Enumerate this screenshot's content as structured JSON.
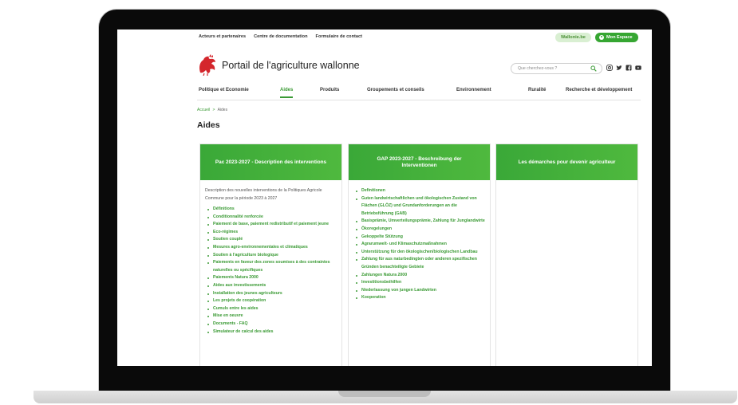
{
  "topbar": {
    "links": [
      "Acteurs et partenaires",
      "Centre de documentation",
      "Formulaire de contact"
    ],
    "wallonie_label": "Wallonie.be",
    "espace_label": "Mon Espace"
  },
  "header": {
    "title": "Portail de l'agriculture wallonne",
    "search_placeholder": "Que cherchez-vous ?"
  },
  "colors": {
    "brand_green": "#36a632",
    "logo_red": "#d4262c"
  },
  "icons": [
    "rooster-logo-icon",
    "search-icon",
    "instagram-icon",
    "twitter-icon",
    "facebook-icon",
    "youtube-icon",
    "user-icon"
  ],
  "nav": {
    "items": [
      "Politique et Economie",
      "Aides",
      "Produits",
      "Groupements et conseils",
      "Environnement",
      "Ruralité",
      "Recherche et développement"
    ],
    "active": "Aides"
  },
  "breadcrumb": {
    "home": "Accueil",
    "separator": ">",
    "current": "Aides"
  },
  "page_title": "Aides",
  "cards": [
    {
      "title": "Pac 2023-2027 - Description des interventions",
      "description": "Description des nouvelles interventions de la Politiques Agricole Commune pour la période 2023 à 2027",
      "links": [
        "Définitions",
        "Conditionnalité renforcée",
        "Paiement de base, paiement redistributif et paiement jeune",
        "Eco-régimes",
        "Soutien couplé",
        "Mesures agro-environnementales et climatiques",
        "Soutien à l'agriculture biologique",
        "Paiements en faveur des zones soumises à des contraintes naturelles ou spécifiques",
        "Paiements Natura 2000",
        "Aides aux investissements",
        "Installation des jeunes agriculteurs",
        "Les projets de coopération",
        "Cumuls entre les aides",
        "Mise en oeuvre",
        "Documents - FAQ",
        "Simulateur de calcul des aides"
      ]
    },
    {
      "title": "GAP 2023-2027 - Beschreibung der Interventionen",
      "description": "",
      "links": [
        "Definitionen",
        "Guten landwirtschaftlichen und ökologischen Zustand von Flächen (GLÖZ) und Grundanforderungen an die Betriebsführung (GAB)",
        "Basisprämie, Umverteilungsprämie, Zahlung für Junglandwirte",
        "Ökoregelungen",
        "Gekoppelte Stützung",
        "Agrarumwelt- und Klimaschutzmaßnahmen",
        "Unterstützung für den ökologischen/biologischen Landbau",
        "Zahlung für aus naturbedingten oder anderen spezifischen Gründen benachteiligte Gebiete",
        "Zahlungen Natura 2000",
        "Investitionsbeihilfen",
        "Niederlassung von jungen Landwirten",
        "Kooperation"
      ]
    },
    {
      "title": "Les démarches pour devenir agriculteur",
      "description": "",
      "links": []
    }
  ]
}
